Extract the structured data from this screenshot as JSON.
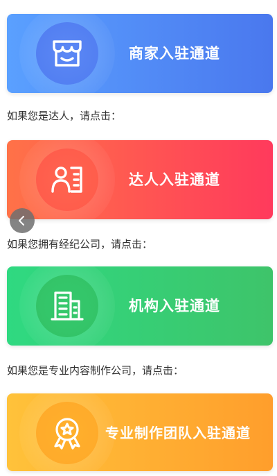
{
  "colors": {
    "merchant": [
      "#5aa0ff",
      "#4a78ee"
    ],
    "influencer": [
      "#ff7248",
      "#ff3a5c"
    ],
    "agency": [
      "#2fd981",
      "#3ec46a"
    ],
    "studio": [
      "#ffc23a",
      "#ff9e2c"
    ]
  },
  "entries": {
    "merchant": {
      "label": "商家入驻通道",
      "icon": "storefront-icon"
    },
    "influencer": {
      "prompt": "如果您是达人，请点击：",
      "label": "达人入驻通道",
      "icon": "person-profile-icon"
    },
    "agency": {
      "prompt": "如果您拥有经纪公司，请点击：",
      "label": "机构入驻通道",
      "icon": "office-building-icon"
    },
    "studio": {
      "prompt": "如果您是专业内容制作公司，请点击：",
      "label": "专业制作团队入驻通道",
      "icon": "award-medal-icon"
    }
  },
  "nav": {
    "back_icon": "chevron-left-icon"
  }
}
